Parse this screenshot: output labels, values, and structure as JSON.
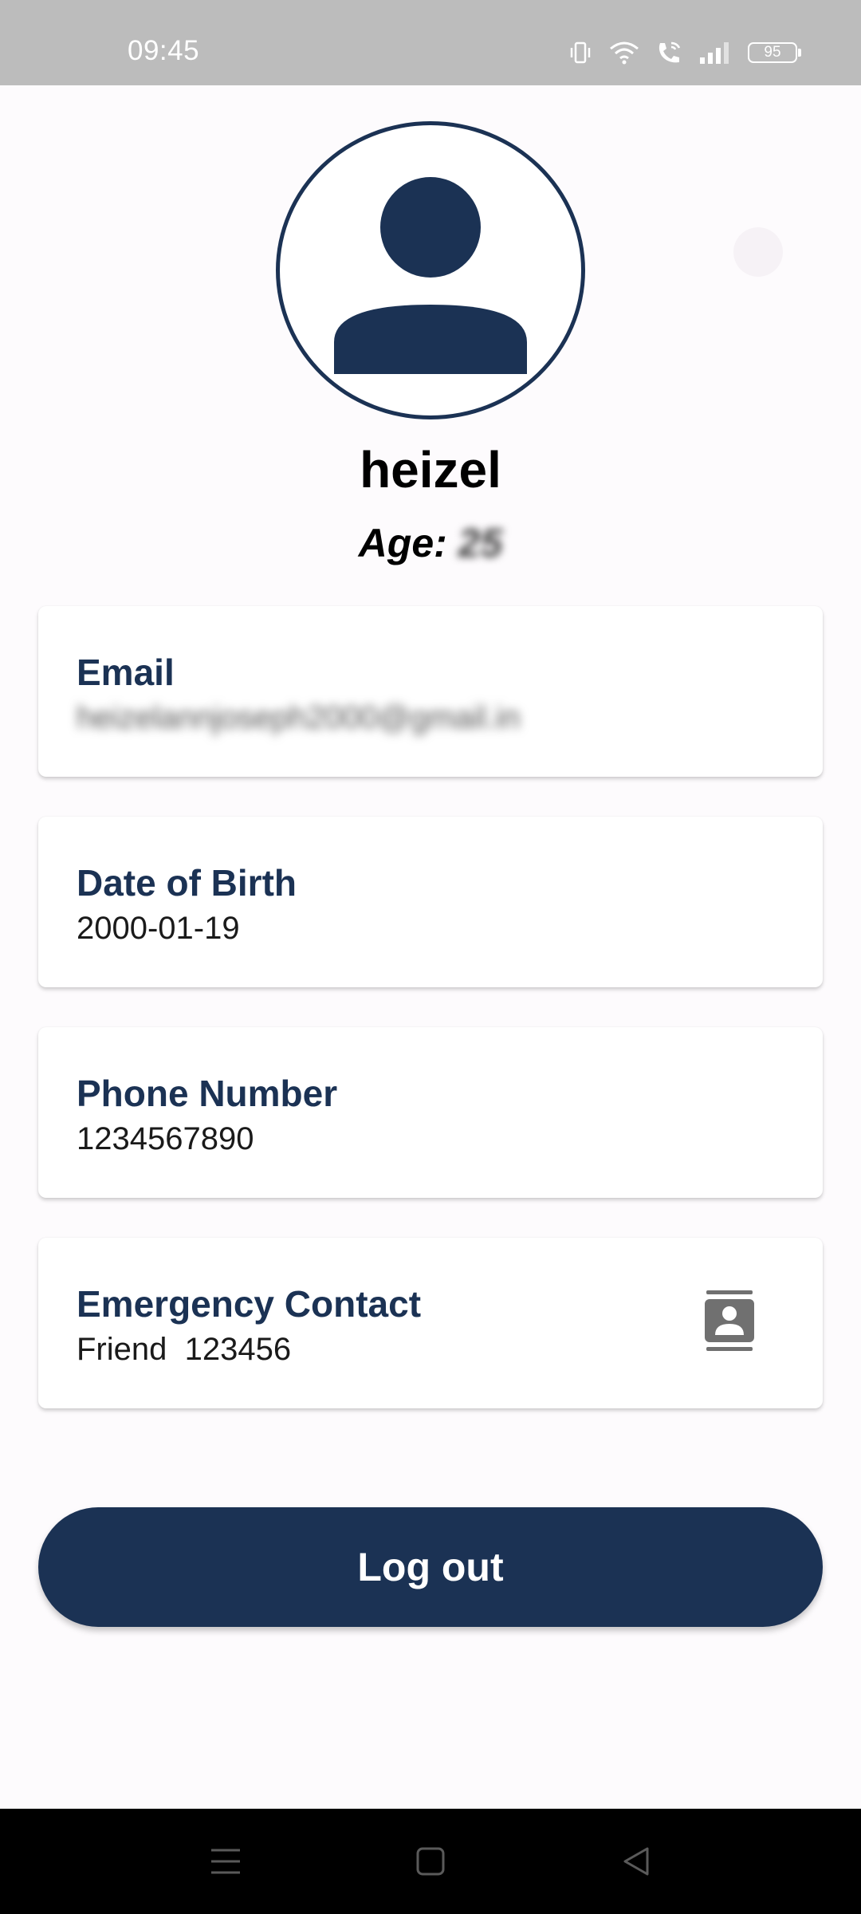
{
  "status_bar": {
    "time": "09:45",
    "battery": "95",
    "icons": [
      "vibrate-icon",
      "wifi-icon",
      "wifi-call-icon",
      "signal-icon",
      "battery-icon"
    ]
  },
  "profile": {
    "name": "heizel",
    "age_label": "Age:",
    "age_value": "25"
  },
  "cards": [
    {
      "label": "Email",
      "value": "heizelannjoseph2000@gmail.in"
    },
    {
      "label": "Date of Birth",
      "value": "2000-01-19"
    },
    {
      "label": "Phone Number",
      "value": "1234567890"
    },
    {
      "label": "Emergency Contact",
      "value": "Friend  123456",
      "icon": "contact-book-icon"
    }
  ],
  "logout": {
    "label": "Log out"
  },
  "nav_bar": {
    "icons": [
      "menu-icon",
      "home-square-icon",
      "back-triangle-icon"
    ]
  },
  "colors": {
    "primary": "#1b3254",
    "status_bar": "#bcbcbc",
    "background": "#fdfbfd"
  }
}
